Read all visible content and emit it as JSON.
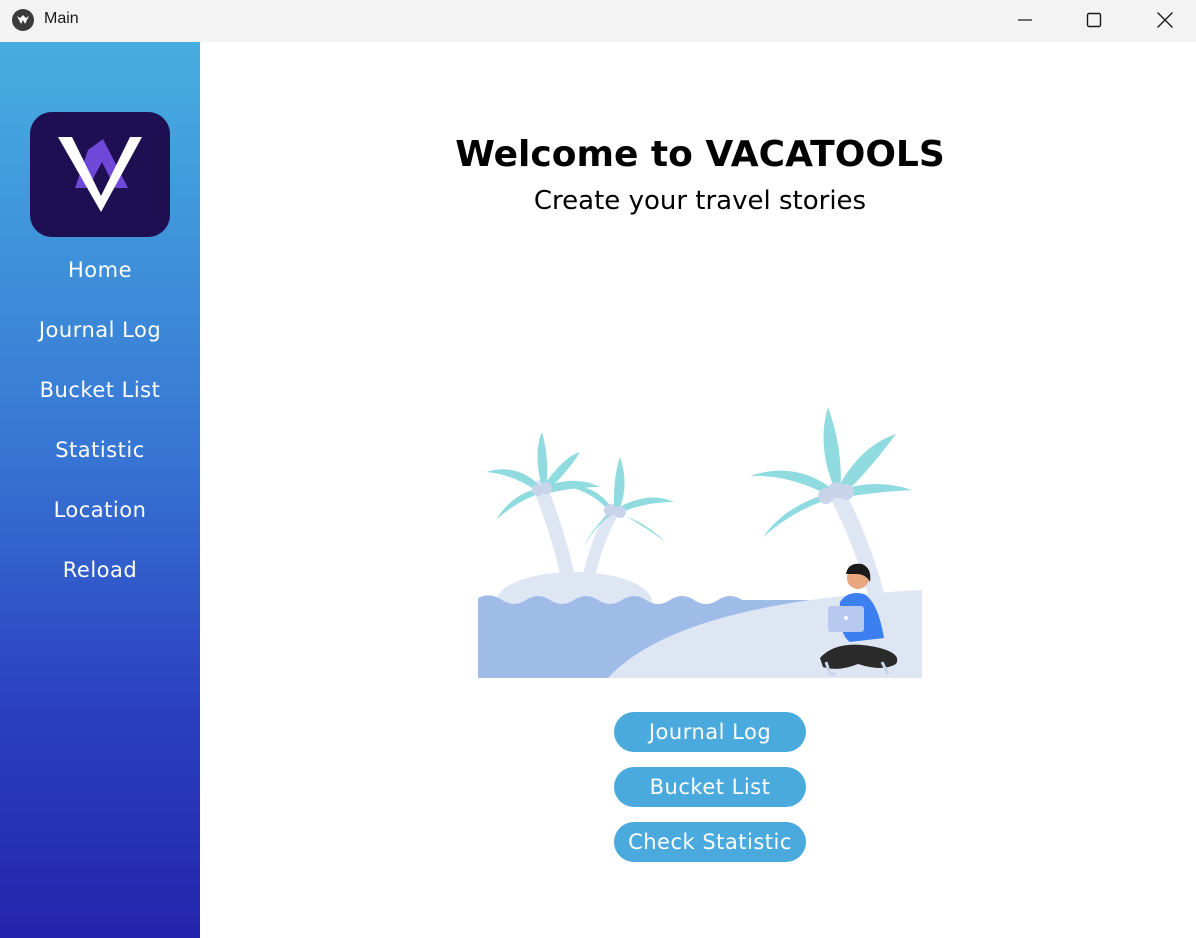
{
  "window": {
    "title": "Main"
  },
  "sidebar": {
    "items": [
      {
        "label": "Home"
      },
      {
        "label": "Journal Log"
      },
      {
        "label": "Bucket List"
      },
      {
        "label": "Statistic"
      },
      {
        "label": "Location"
      },
      {
        "label": "Reload"
      }
    ]
  },
  "main": {
    "title": "Welcome to VACATOOLS",
    "subtitle": "Create your travel stories",
    "buttons": [
      {
        "label": "Journal Log"
      },
      {
        "label": "Bucket List"
      },
      {
        "label": "Check Statistic"
      }
    ]
  },
  "colors": {
    "sidebar_top": "#46aee0",
    "sidebar_bottom": "#2324ad",
    "button": "#4aa9dd",
    "logo_bg": "#1e0e52"
  },
  "icons": [
    "app-icon",
    "minimize-icon",
    "maximize-icon",
    "close-icon",
    "vacatools-logo-icon",
    "beach-illustration"
  ]
}
